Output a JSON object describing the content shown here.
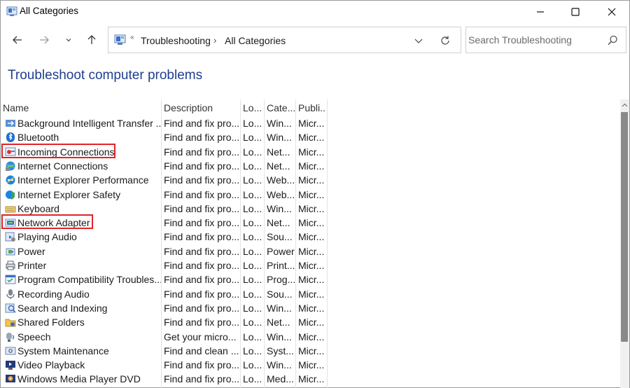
{
  "window": {
    "title": "All Categories"
  },
  "nav": {
    "breadcrumb": [
      "Troubleshooting",
      "All Categories"
    ],
    "overflow_glyph": "«",
    "crumb_separator": "›",
    "search_placeholder": "Search Troubleshooting"
  },
  "page": {
    "title": "Troubleshoot computer problems"
  },
  "table": {
    "columns": [
      "Name",
      "Description",
      "Lo...",
      "Cate...",
      "Publi..."
    ],
    "rows": [
      {
        "name": "Background Intelligent Transfer ...",
        "desc": "Find and fix pro...",
        "loc": "Lo...",
        "cat": "Win...",
        "pub": "Micr...",
        "icon": "bits-icon"
      },
      {
        "name": "Bluetooth",
        "desc": "Find and fix pro...",
        "loc": "Lo...",
        "cat": "Win...",
        "pub": "Micr...",
        "icon": "bluetooth-icon"
      },
      {
        "name": "Incoming Connections",
        "desc": "Find and fix pro...",
        "loc": "Lo...",
        "cat": "Net...",
        "pub": "Micr...",
        "icon": "incoming-connections-icon"
      },
      {
        "name": "Internet Connections",
        "desc": "Find and fix pro...",
        "loc": "Lo...",
        "cat": "Net...",
        "pub": "Micr...",
        "icon": "internet-connections-icon"
      },
      {
        "name": "Internet Explorer Performance",
        "desc": "Find and fix pro...",
        "loc": "Lo...",
        "cat": "Web...",
        "pub": "Micr...",
        "icon": "ie-performance-icon"
      },
      {
        "name": "Internet Explorer Safety",
        "desc": "Find and fix pro...",
        "loc": "Lo...",
        "cat": "Web...",
        "pub": "Micr...",
        "icon": "ie-safety-icon"
      },
      {
        "name": "Keyboard",
        "desc": "Find and fix pro...",
        "loc": "Lo...",
        "cat": "Win...",
        "pub": "Micr...",
        "icon": "keyboard-icon"
      },
      {
        "name": "Network Adapter",
        "desc": "Find and fix pro...",
        "loc": "Lo...",
        "cat": "Net...",
        "pub": "Micr...",
        "icon": "network-adapter-icon"
      },
      {
        "name": "Playing Audio",
        "desc": "Find and fix pro...",
        "loc": "Lo...",
        "cat": "Sou...",
        "pub": "Micr...",
        "icon": "playing-audio-icon"
      },
      {
        "name": "Power",
        "desc": "Find and fix pro...",
        "loc": "Lo...",
        "cat": "Power",
        "pub": "Micr...",
        "icon": "power-icon"
      },
      {
        "name": "Printer",
        "desc": "Find and fix pro...",
        "loc": "Lo...",
        "cat": "Print...",
        "pub": "Micr...",
        "icon": "printer-icon"
      },
      {
        "name": "Program Compatibility Troubles...",
        "desc": "Find and fix pro...",
        "loc": "Lo...",
        "cat": "Prog...",
        "pub": "Micr...",
        "icon": "program-compatibility-icon"
      },
      {
        "name": "Recording Audio",
        "desc": "Find and fix pro...",
        "loc": "Lo...",
        "cat": "Sou...",
        "pub": "Micr...",
        "icon": "recording-audio-icon"
      },
      {
        "name": "Search and Indexing",
        "desc": "Find and fix pro...",
        "loc": "Lo...",
        "cat": "Win...",
        "pub": "Micr...",
        "icon": "search-indexing-icon"
      },
      {
        "name": "Shared Folders",
        "desc": "Find and fix pro...",
        "loc": "Lo...",
        "cat": "Net...",
        "pub": "Micr...",
        "icon": "shared-folders-icon"
      },
      {
        "name": "Speech",
        "desc": "Get your micro...",
        "loc": "Lo...",
        "cat": "Win...",
        "pub": "Micr...",
        "icon": "speech-icon"
      },
      {
        "name": "System Maintenance",
        "desc": "Find and clean ...",
        "loc": "Lo...",
        "cat": "Syst...",
        "pub": "Micr...",
        "icon": "system-maintenance-icon"
      },
      {
        "name": "Video Playback",
        "desc": "Find and fix pro...",
        "loc": "Lo...",
        "cat": "Win...",
        "pub": "Micr...",
        "icon": "video-playback-icon"
      },
      {
        "name": "Windows Media Player DVD",
        "desc": "Find and fix pro...",
        "loc": "Lo...",
        "cat": "Med...",
        "pub": "Micr...",
        "icon": "wmp-dvd-icon"
      }
    ],
    "highlighted_rows": [
      "Incoming Connections",
      "Network Adapter"
    ]
  },
  "colors": {
    "title_blue": "#1e3e8f",
    "highlight_red": "#e0242a",
    "scroll_thumb": "#8a8a8a"
  }
}
